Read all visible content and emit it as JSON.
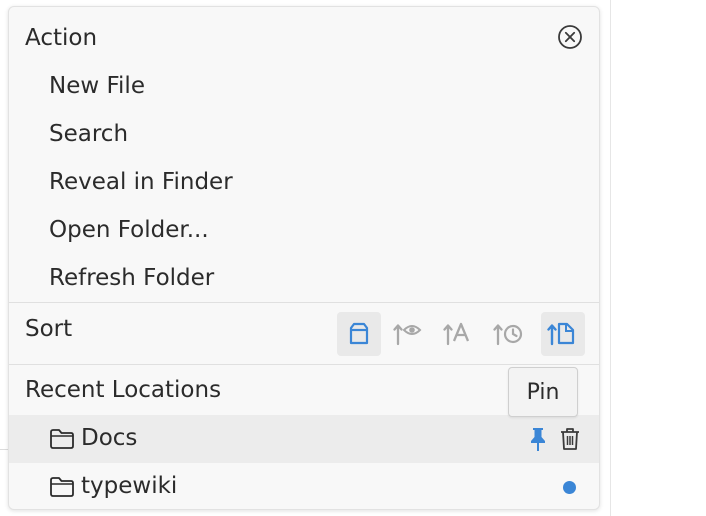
{
  "action": {
    "title": "Action",
    "items": [
      {
        "label": "New File"
      },
      {
        "label": "Search"
      },
      {
        "label": "Reveal in Finder"
      },
      {
        "label": "Open Folder..."
      },
      {
        "label": "Refresh Folder"
      }
    ]
  },
  "sort": {
    "title": "Sort",
    "options": [
      {
        "icon": "file-type-icon",
        "active": true
      },
      {
        "icon": "sort-by-visited-icon",
        "active": false
      },
      {
        "icon": "sort-by-name-icon",
        "active": false
      },
      {
        "icon": "sort-by-modified-icon",
        "active": false
      },
      {
        "icon": "sort-ascending-file-icon",
        "active": true
      }
    ]
  },
  "recent": {
    "title": "Recent Locations",
    "tooltip": "Pin",
    "items": [
      {
        "label": "Docs",
        "hovered": true
      },
      {
        "label": "typewiki",
        "current": true
      }
    ]
  },
  "colors": {
    "accent": "#3b86d6",
    "panel_bg": "#f8f8f8",
    "hover_bg": "#ececec",
    "icon_gray": "#a8a8a8",
    "text": "#2b2b2b"
  }
}
